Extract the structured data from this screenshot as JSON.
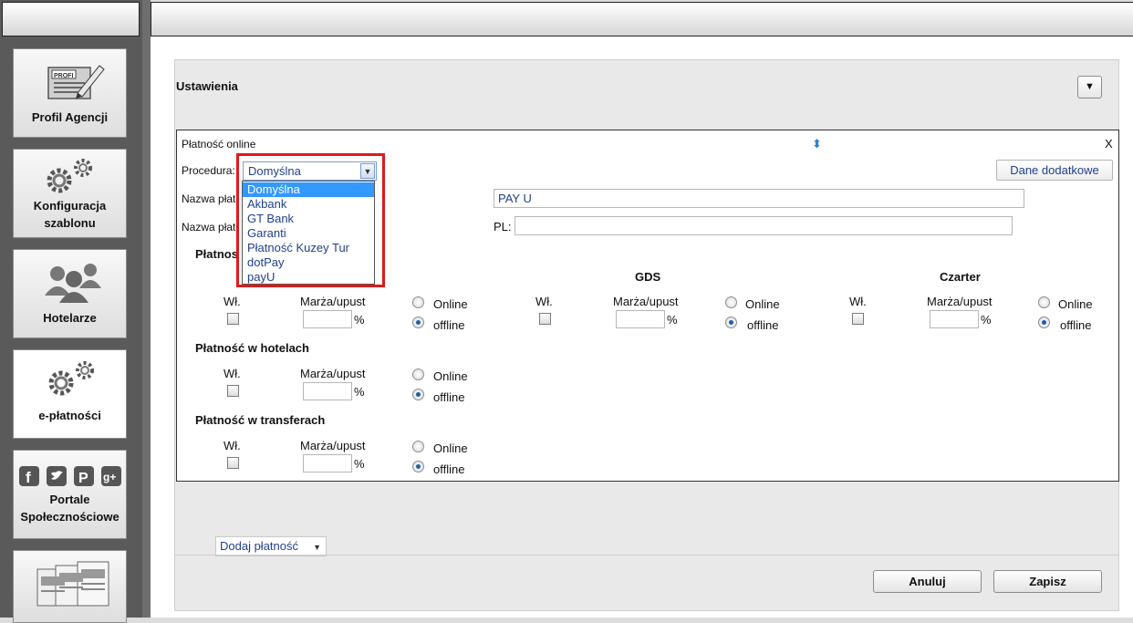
{
  "sidebar": {
    "items": [
      {
        "label": "Profil Agencji",
        "icon": "profile-card-icon"
      },
      {
        "label": "Konfiguracja szablonu",
        "icon": "gears-icon"
      },
      {
        "label": "Hotelarze",
        "icon": "users-icon"
      },
      {
        "label": "e-płatności",
        "icon": "gears-icon"
      },
      {
        "label": "Portale Społecznościowe",
        "icon": "social-icons"
      },
      {
        "label": "",
        "icon": "documents-icon"
      }
    ]
  },
  "panel": {
    "title": "Ustawienia",
    "collapse_glyph": "▼"
  },
  "online_box": {
    "title": "Płatność online",
    "drag_glyph": "⬍",
    "close_label": "X",
    "procedura_label": "Procedura:",
    "selected_procedure": "Domyślna",
    "dane_button": "Dane dodatkowe",
    "name_label_1": "Nazwa płat",
    "name_label_2": "Nazwa płat",
    "name_value": "PAY U",
    "pl_label": "PL:",
    "section_online_title": "Płatnos",
    "gds_title": "GDS",
    "czarter_title": "Czarter",
    "wl_label": "Wł.",
    "marza_label": "Marża/upust",
    "percent": "%",
    "online_label": "Online",
    "offline_label": "offline",
    "section_hotels_title": "Płatność w hotelach",
    "section_transfers_title": "Płatność w transferach"
  },
  "dropdown": {
    "options": [
      "Domyślna",
      "Akbank",
      "GT Bank",
      "Garanti",
      "Płatność Kuzey Tur",
      "dotPay",
      "payU"
    ],
    "selected_index": 0
  },
  "footer": {
    "dodaj_label": "Dodaj płatność",
    "anuluj_label": "Anuluj",
    "zapisz_label": "Zapisz"
  }
}
